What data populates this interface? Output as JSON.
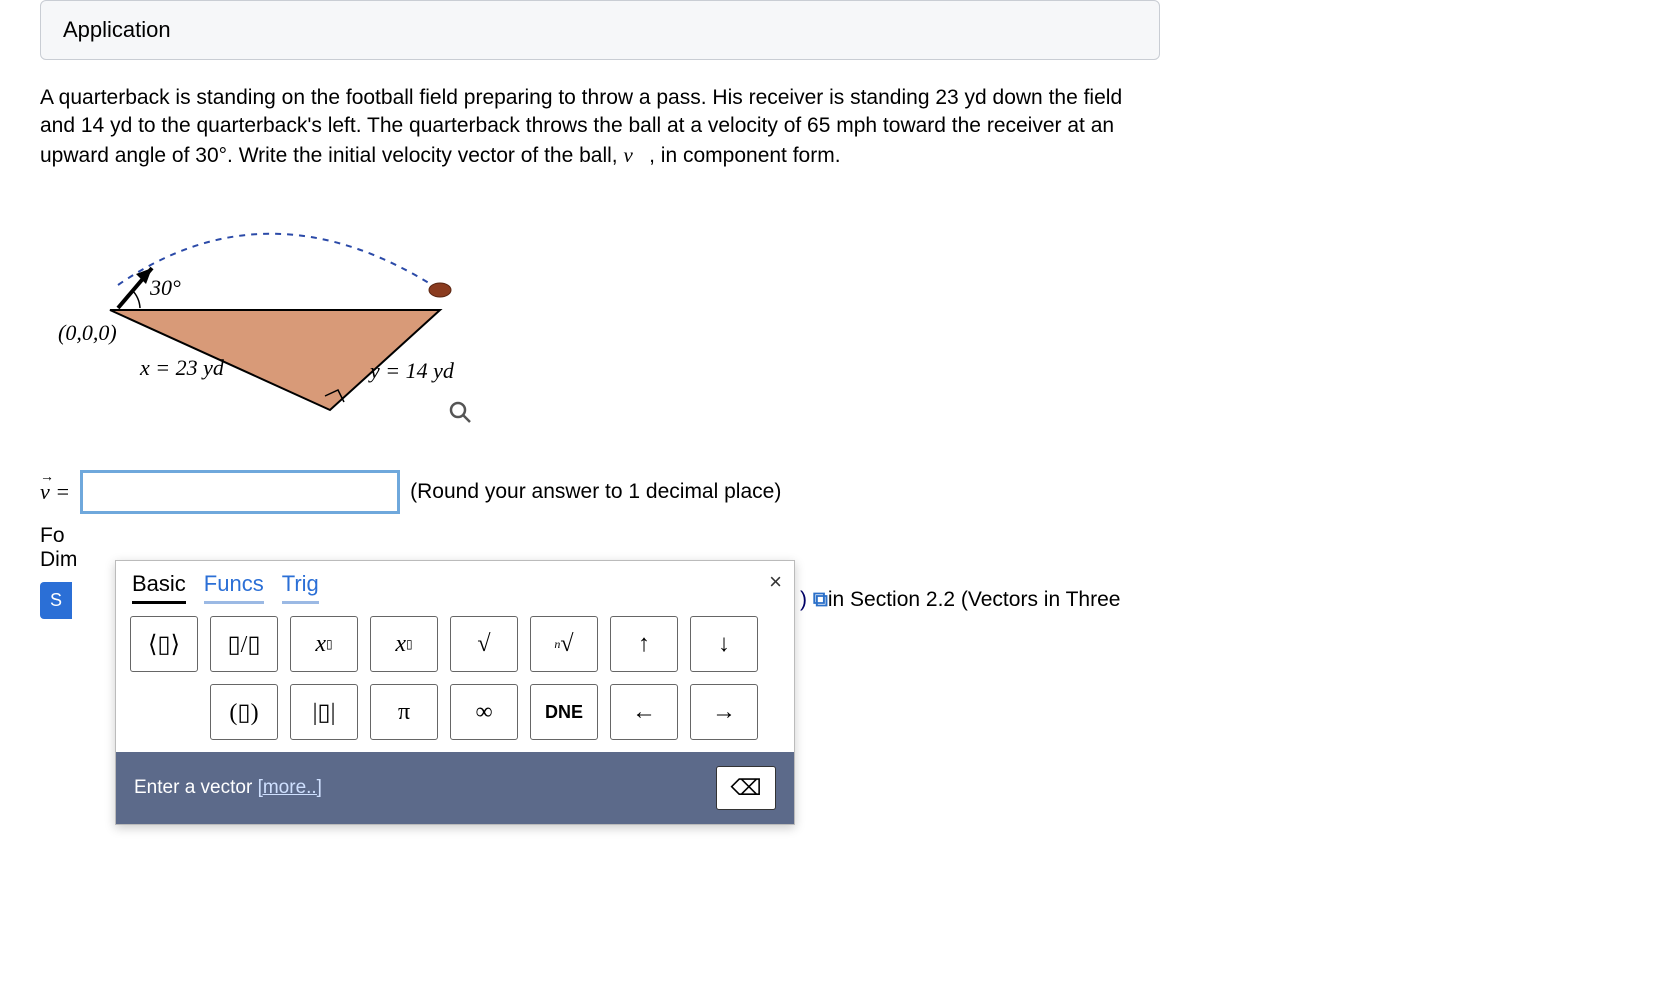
{
  "header": {
    "title": "Application"
  },
  "problem": {
    "text": "A quarterback is standing on the football field preparing to throw a pass. His receiver is standing 23 yd down the field and 14 yd to the quarterback's left. The quarterback throws the ball at a velocity of 65 mph toward the receiver at an upward angle of 30°. Write the initial velocity vector of the ball, ",
    "vector_symbol": "v⃗",
    "text_after": ", in component form."
  },
  "diagram": {
    "angle_label": "30°",
    "origin_label": "(0,0,0)",
    "x_label": "x = 23 yd",
    "y_label": "y = 14 yd"
  },
  "answer": {
    "prefix": "v⃗ =",
    "value": "",
    "round_note": "(Round your answer to 1 decimal place)"
  },
  "hint": {
    "prefix_fragment_1": "Fo",
    "prefix_fragment_2": "Dim",
    "link_tail": ") ",
    "section_text": "in Section 2.2 (Vectors in Three"
  },
  "submit": {
    "label_fragment": "S"
  },
  "keypad": {
    "tabs": [
      "Basic",
      "Funcs",
      "Trig"
    ],
    "row1": [
      "⟨▯⟩",
      "▯/▯",
      "x^▯",
      "x_▯",
      "√",
      "ⁿ√",
      "↑",
      "↓"
    ],
    "row2": [
      "",
      "(▯)",
      "|▯|",
      "π",
      "∞",
      "DNE",
      "←",
      "→"
    ],
    "footer_text": "Enter a vector ",
    "footer_more": "[more..]"
  }
}
